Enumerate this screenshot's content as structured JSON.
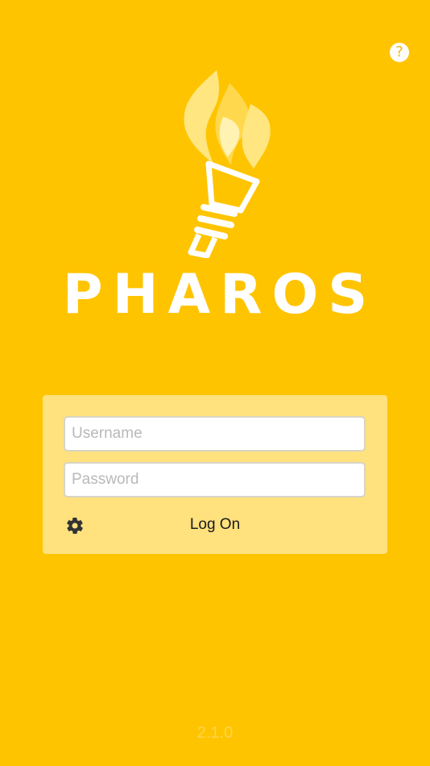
{
  "header": {
    "help_icon": "question-icon",
    "help_label": "?"
  },
  "brand": {
    "logo_icon": "torch-icon",
    "name": "PHAROS"
  },
  "login": {
    "username_placeholder": "Username",
    "username_value": "",
    "password_placeholder": "Password",
    "password_value": "",
    "settings_icon": "gear-icon",
    "logon_label": "Log On"
  },
  "footer": {
    "version": "2.1.0"
  },
  "colors": {
    "background": "#FFC400",
    "card": "#FFE17E",
    "text_light": "#FFFFFF",
    "flame_light": "#FFE680"
  }
}
